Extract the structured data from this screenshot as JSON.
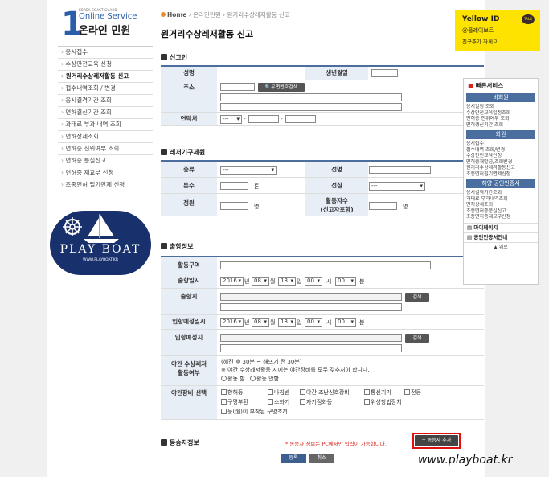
{
  "header": {
    "number": "1",
    "small": "KOREA COAST GUARD",
    "sub": "Online Service",
    "title": "온라인 민원"
  },
  "sidebar": {
    "items": [
      {
        "label": "응시접수"
      },
      {
        "label": "수상안전교육 신청"
      },
      {
        "label": "원거리수상레저활동 신고"
      },
      {
        "label": "접수내역조회 / 변경"
      },
      {
        "label": "응시결격기간 조회"
      },
      {
        "label": "면허결신기간 조회"
      },
      {
        "label": "과태료 부과 내역 조회"
      },
      {
        "label": "면허상세조회"
      },
      {
        "label": "면허증 진위여부 조회"
      },
      {
        "label": "면허증 분실신고"
      },
      {
        "label": "면허증 재교부 신청"
      },
      {
        "label": "조종면허 필기면제 신청"
      }
    ]
  },
  "badge": {
    "text": "PLAY BOAT",
    "url": "WWW.PLAYBOAT.KR"
  },
  "breadcrumb": {
    "home": "Home",
    "level1": "온라인민원",
    "level2": "원거리수상레저활동 신고"
  },
  "page_title": "원거리수상레저활동 신고",
  "sections": {
    "reporter": "신고인",
    "equipment": "레저기구제원",
    "departure": "출항정보",
    "companion": "동승자정보"
  },
  "reporter": {
    "name_label": "성명",
    "birth_label": "생년월일",
    "address_label": "주소",
    "zip_button": "우편번호검색",
    "phone_label": "연락처",
    "phone_prefix": "---"
  },
  "equipment": {
    "type_label": "종류",
    "type_value": "---",
    "ship_name_label": "선명",
    "tonnage_label": "톤수",
    "tonnage_unit": "톤",
    "hull_label": "선질",
    "hull_value": "---",
    "capacity_label": "정원",
    "capacity_unit": "명",
    "crew_label": "활동자수",
    "crew_label2": "(신고자포함)",
    "crew_unit": "명"
  },
  "departure": {
    "area_label": "활동구역",
    "depart_time_label": "출항일시",
    "year": "2016",
    "month": "08",
    "day": "18",
    "hour": "00",
    "minute": "00",
    "u_year": "년",
    "u_month": "월",
    "u_day": "일",
    "u_hour": "시",
    "u_minute": "분",
    "depart_place_label": "출항지",
    "search_button": "검색",
    "arrive_time_label": "입항예정일시",
    "arrive_place_label": "입항예정지",
    "night_label": "야간 수상레저",
    "night_label2": "활동여부",
    "night_note1": "(해진 후 30분 ~ 해뜨기 전 30분)",
    "night_note2": "※ 야간 수상레저활동 시에는 야간장비를 모두 갖추셔야 합니다.",
    "night_yes": "활동 함",
    "night_no": "활동 안함",
    "gear_label": "야간장비 선택",
    "gear_items": [
      "항해등",
      "나침반",
      "야간 조난신호장비",
      "통신기기",
      "전등",
      "구명부환",
      "소화기",
      "자기점화등",
      "위성항법장치",
      "등(燈)이 부착된 구명조끼"
    ]
  },
  "companion": {
    "notice": "* 동승자 정보는 PC에서만 입력이 가능합니다.",
    "add_button": "동승자 추가"
  },
  "actions": {
    "submit": "등록",
    "cancel": "취소"
  },
  "yellow_id": {
    "title": "Yellow ID",
    "talk": "TALK",
    "handle": "@플레이보트",
    "cta": "친구추가 하세요."
  },
  "quick": {
    "title": "빠른서비스",
    "groups": [
      {
        "head": "비회원",
        "links": [
          "응시일정 조회",
          "수상안전교육일정조회",
          "면허증 진위여부 조회",
          "면허갱신기간 조회"
        ]
      },
      {
        "head": "회원",
        "links": [
          "응시접수",
          "접수내역 조회/변경",
          "수상안전교육신청",
          "면허증재발급/조회변경",
          "원거리수상레저활동신고",
          "조종면허필기면제신청"
        ]
      },
      {
        "head": "해양·공인인증서",
        "links": [
          "응시결격기간조회",
          "과태료 부과내역조회",
          "면허상세조회",
          "조종면허증분실신고",
          "조종면허증재교부신청"
        ]
      }
    ],
    "mypage": "마이페이지",
    "cert": "공인인증서안내",
    "top": "위로"
  },
  "watermark": "www.playboat.kr"
}
